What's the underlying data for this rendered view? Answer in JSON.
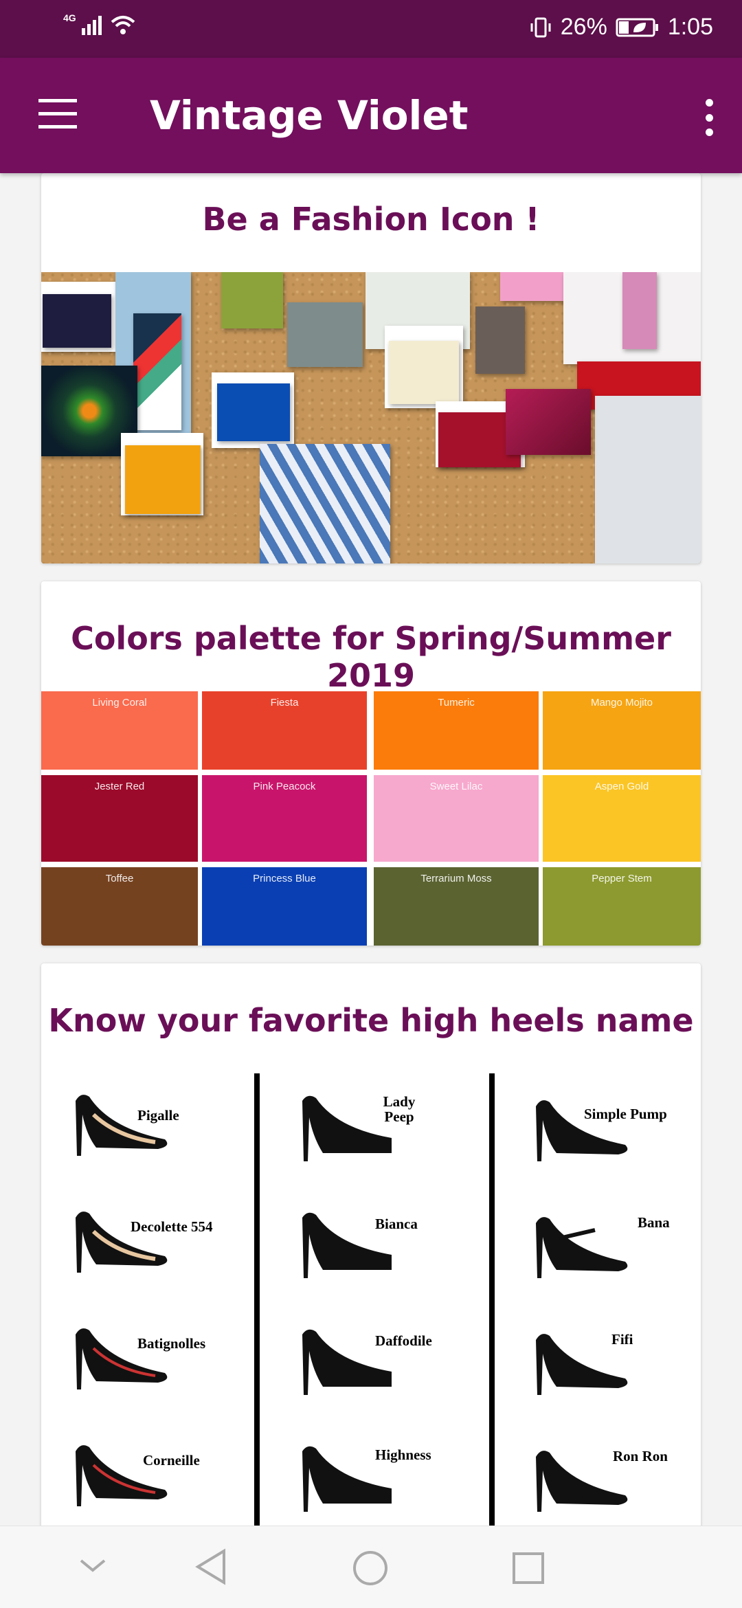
{
  "status_bar": {
    "network_type": "4G",
    "battery_percent": "26%",
    "time": "1:05"
  },
  "app_bar": {
    "title": "Vintage Violet",
    "menu_icon": "hamburger-menu-icon",
    "overflow_icon": "more-vertical-icon"
  },
  "cards": {
    "fashion": {
      "title": "Be a Fashion Icon !"
    },
    "palette": {
      "title": "Colors palette for Spring/Summer 2019",
      "colors": [
        {
          "name": "Living Coral",
          "hex": "#fa6a4d"
        },
        {
          "name": "Fiesta",
          "hex": "#e8412b"
        },
        {
          "name": "Tumeric",
          "hex": "#fb7c0a"
        },
        {
          "name": "Mango Mojito",
          "hex": "#f6a412"
        },
        {
          "name": "Jester Red",
          "hex": "#9b0a2a"
        },
        {
          "name": "Pink Peacock",
          "hex": "#c8156b"
        },
        {
          "name": "Sweet Lilac",
          "hex": "#f7a8cd"
        },
        {
          "name": "Aspen Gold",
          "hex": "#fbc526"
        },
        {
          "name": "Toffee",
          "hex": "#754220"
        },
        {
          "name": "Princess Blue",
          "hex": "#0a3fb3"
        },
        {
          "name": "Terrarium Moss",
          "hex": "#5b6331"
        },
        {
          "name": "Pepper Stem",
          "hex": "#8d9a2f"
        }
      ]
    },
    "heels": {
      "title": "Know your favorite high heels name",
      "columns": [
        [
          "Pigalle",
          "Decolette 554",
          "Batignolles",
          "Corneille"
        ],
        [
          "Lady Peep",
          "Bianca",
          "Daffodile",
          "Highness"
        ],
        [
          "Simple Pump",
          "Bana",
          "Fifi",
          "Ron Ron"
        ]
      ]
    }
  },
  "nav_bar": {
    "icons": [
      "chevron-down-icon",
      "back-triangle-icon",
      "home-circle-icon",
      "recents-square-icon"
    ]
  },
  "colors": {
    "status_bar": "#5c0f4a",
    "app_bar": "#730f5d",
    "title_accent": "#6a0f57"
  }
}
